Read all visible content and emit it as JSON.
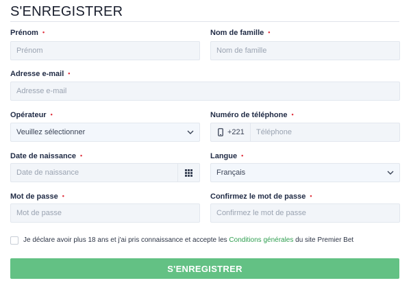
{
  "form": {
    "title": "S'ENREGISTRER",
    "required_marker": "•",
    "fields": {
      "first_name": {
        "label": "Prénom",
        "placeholder": "Prénom"
      },
      "last_name": {
        "label": "Nom de famille",
        "placeholder": "Nom de famille"
      },
      "email": {
        "label": "Adresse e-mail",
        "placeholder": "Adresse e-mail"
      },
      "operator": {
        "label": "Opérateur",
        "value": "Veuillez sélectionner"
      },
      "phone": {
        "label": "Numéro de téléphone",
        "prefix": "+221",
        "placeholder": "Téléphone"
      },
      "birth_date": {
        "label": "Date de naissance",
        "placeholder": "Date de naissance"
      },
      "language": {
        "label": "Langue",
        "value": "Français"
      },
      "password": {
        "label": "Mot de passe",
        "placeholder": "Mot de passe"
      },
      "password_confirm": {
        "label": "Confirmez le mot de passe",
        "placeholder": "Confirmez le mot de passe"
      }
    },
    "consent": {
      "text_before": "Je déclare avoir plus 18 ans et j'ai pris connaissance et accepte les ",
      "link_text": "Conditions générales",
      "text_after": " du site Premier Bet",
      "checked": false
    },
    "submit_label": "S'ENREGISTRER",
    "colors": {
      "accent": "#63c184",
      "link": "#2e9e4f",
      "required": "#e0333f",
      "field_bg": "#f2f5f9"
    },
    "icons": {
      "phone_prefix": "mobile-phone-icon",
      "birth_date": "calendar-grid-icon",
      "select": "chevron-down-icon"
    }
  }
}
